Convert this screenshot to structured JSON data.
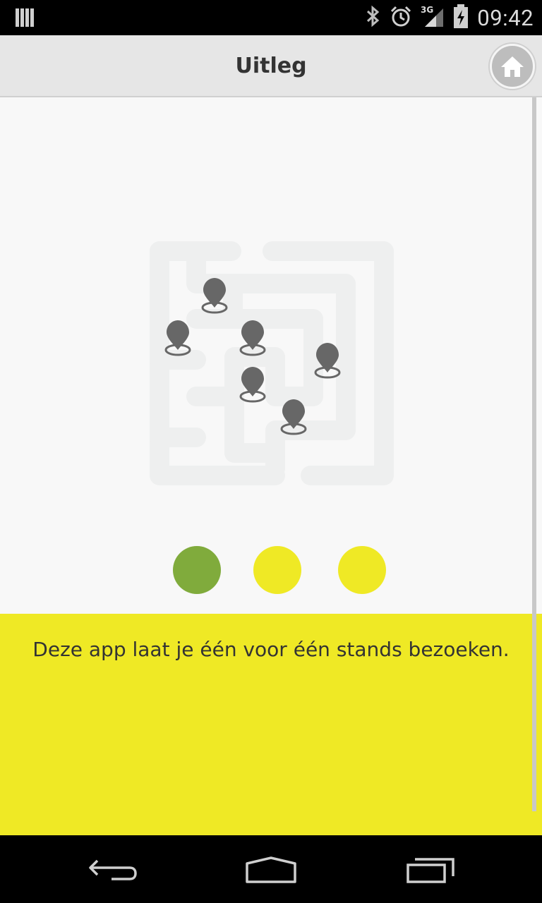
{
  "status_bar": {
    "time": "09:42",
    "network": "3G",
    "icons": [
      "notification-icon",
      "bluetooth-icon",
      "alarm-icon",
      "signal-icon",
      "battery-icon"
    ]
  },
  "header": {
    "title": "Uitleg",
    "home_icon": "home-icon"
  },
  "illustration": {
    "name": "maze-with-location-pins",
    "pin_count": 6
  },
  "pager": {
    "pages": 3,
    "active_index": 0,
    "active_color": "#80ab3c",
    "inactive_color": "#efe925"
  },
  "info": {
    "text": "Deze app laat je één voor één stands bezoeken."
  },
  "colors": {
    "accent_yellow": "#efe925",
    "accent_green": "#80ab3c",
    "pin_gray": "#666666",
    "maze_gray": "#eeefef"
  },
  "nav_bar": {
    "buttons": [
      "back-icon",
      "home-nav-icon",
      "recents-icon"
    ]
  }
}
